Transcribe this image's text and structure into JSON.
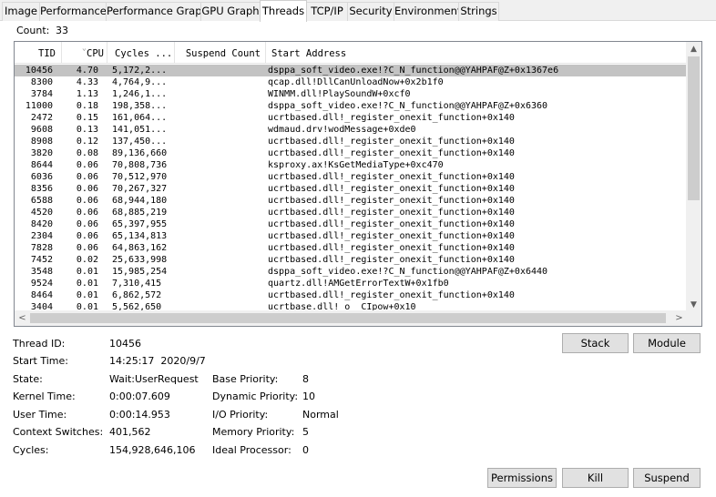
{
  "tabs": [
    {
      "label": "Image"
    },
    {
      "label": "Performance"
    },
    {
      "label": "Performance Graph"
    },
    {
      "label": "GPU Graph"
    },
    {
      "label": "Threads"
    },
    {
      "label": "TCP/IP"
    },
    {
      "label": "Security"
    },
    {
      "label": "Environment"
    },
    {
      "label": "Strings"
    }
  ],
  "active_tab": "Threads",
  "count": {
    "label": "Count:",
    "value": "33"
  },
  "columns": {
    "tid": "TID",
    "cpu": "CPU",
    "cycles": "Cycles ...",
    "suspend": "Suspend Count",
    "address": "Start Address"
  },
  "rows": [
    {
      "tid": "10456",
      "cpu": "4.70",
      "cycles": "5,172,2...",
      "address": "dsppa_soft_video.exe!?C_N_function@@YAHPAF@Z+0x1367e6",
      "selected": true
    },
    {
      "tid": "8300",
      "cpu": "4.33",
      "cycles": "4,764,9...",
      "address": "qcap.dll!DllCanUnloadNow+0x2b1f0"
    },
    {
      "tid": "3784",
      "cpu": "1.13",
      "cycles": "1,246,1...",
      "address": "WINMM.dll!PlaySoundW+0xcf0"
    },
    {
      "tid": "11000",
      "cpu": "0.18",
      "cycles": "198,358...",
      "address": "dsppa_soft_video.exe!?C_N_function@@YAHPAF@Z+0x6360"
    },
    {
      "tid": "2472",
      "cpu": "0.15",
      "cycles": "161,064...",
      "address": "ucrtbased.dll!_register_onexit_function+0x140"
    },
    {
      "tid": "9608",
      "cpu": "0.13",
      "cycles": "141,051...",
      "address": "wdmaud.drv!wodMessage+0xde0"
    },
    {
      "tid": "8908",
      "cpu": "0.12",
      "cycles": "137,450...",
      "address": "ucrtbased.dll!_register_onexit_function+0x140"
    },
    {
      "tid": "3820",
      "cpu": "0.08",
      "cycles": "89,136,660",
      "address": "ucrtbased.dll!_register_onexit_function+0x140"
    },
    {
      "tid": "8644",
      "cpu": "0.06",
      "cycles": "70,808,736",
      "address": "ksproxy.ax!KsGetMediaType+0xc470"
    },
    {
      "tid": "6036",
      "cpu": "0.06",
      "cycles": "70,512,970",
      "address": "ucrtbased.dll!_register_onexit_function+0x140"
    },
    {
      "tid": "8356",
      "cpu": "0.06",
      "cycles": "70,267,327",
      "address": "ucrtbased.dll!_register_onexit_function+0x140"
    },
    {
      "tid": "6588",
      "cpu": "0.06",
      "cycles": "68,944,180",
      "address": "ucrtbased.dll!_register_onexit_function+0x140"
    },
    {
      "tid": "4520",
      "cpu": "0.06",
      "cycles": "68,885,219",
      "address": "ucrtbased.dll!_register_onexit_function+0x140"
    },
    {
      "tid": "8420",
      "cpu": "0.06",
      "cycles": "65,397,955",
      "address": "ucrtbased.dll!_register_onexit_function+0x140"
    },
    {
      "tid": "2304",
      "cpu": "0.06",
      "cycles": "65,134,813",
      "address": "ucrtbased.dll!_register_onexit_function+0x140"
    },
    {
      "tid": "7828",
      "cpu": "0.06",
      "cycles": "64,863,162",
      "address": "ucrtbased.dll!_register_onexit_function+0x140"
    },
    {
      "tid": "7452",
      "cpu": "0.02",
      "cycles": "25,633,998",
      "address": "ucrtbased.dll!_register_onexit_function+0x140"
    },
    {
      "tid": "3548",
      "cpu": "0.01",
      "cycles": "15,985,254",
      "address": "dsppa_soft_video.exe!?C_N_function@@YAHPAF@Z+0x6440"
    },
    {
      "tid": "9524",
      "cpu": "0.01",
      "cycles": "7,310,415",
      "address": "quartz.dll!AMGetErrorTextW+0x1fb0"
    },
    {
      "tid": "8464",
      "cpu": "0.01",
      "cycles": "6,862,572",
      "address": "ucrtbased.dll!_register_onexit_function+0x140"
    },
    {
      "tid": "3404",
      "cpu": "0.01",
      "cycles": "5,562,650",
      "address": "ucrtbase.dll!_o__CIpow+0x10"
    }
  ],
  "details": {
    "thread_id": {
      "label": "Thread ID:",
      "value": "10456"
    },
    "start_time": {
      "label": "Start Time:",
      "value": "14:25:17  2020/9/7"
    },
    "state": {
      "label": "State:",
      "value": "Wait:UserRequest"
    },
    "kernel_time": {
      "label": "Kernel Time:",
      "value": "0:00:07.609"
    },
    "user_time": {
      "label": "User Time:",
      "value": "0:00:14.953"
    },
    "context_switches": {
      "label": "Context Switches:",
      "value": "401,562"
    },
    "cycles": {
      "label": "Cycles:",
      "value": "154,928,646,106"
    },
    "base_priority": {
      "label": "Base Priority:",
      "value": "8"
    },
    "dynamic_priority": {
      "label": "Dynamic Priority:",
      "value": "10"
    },
    "io_priority": {
      "label": "I/O Priority:",
      "value": "Normal"
    },
    "memory_priority": {
      "label": "Memory Priority:",
      "value": "5"
    },
    "ideal_processor": {
      "label": "Ideal Processor:",
      "value": "0"
    }
  },
  "buttons": {
    "stack": "Stack",
    "module": "Module",
    "permissions": "Permissions",
    "kill": "Kill",
    "suspend": "Suspend"
  },
  "icons": {
    "scroll_up": "▲",
    "scroll_down": "▼",
    "scroll_left": "<",
    "scroll_right": ">",
    "sort_ind": "⌄"
  }
}
